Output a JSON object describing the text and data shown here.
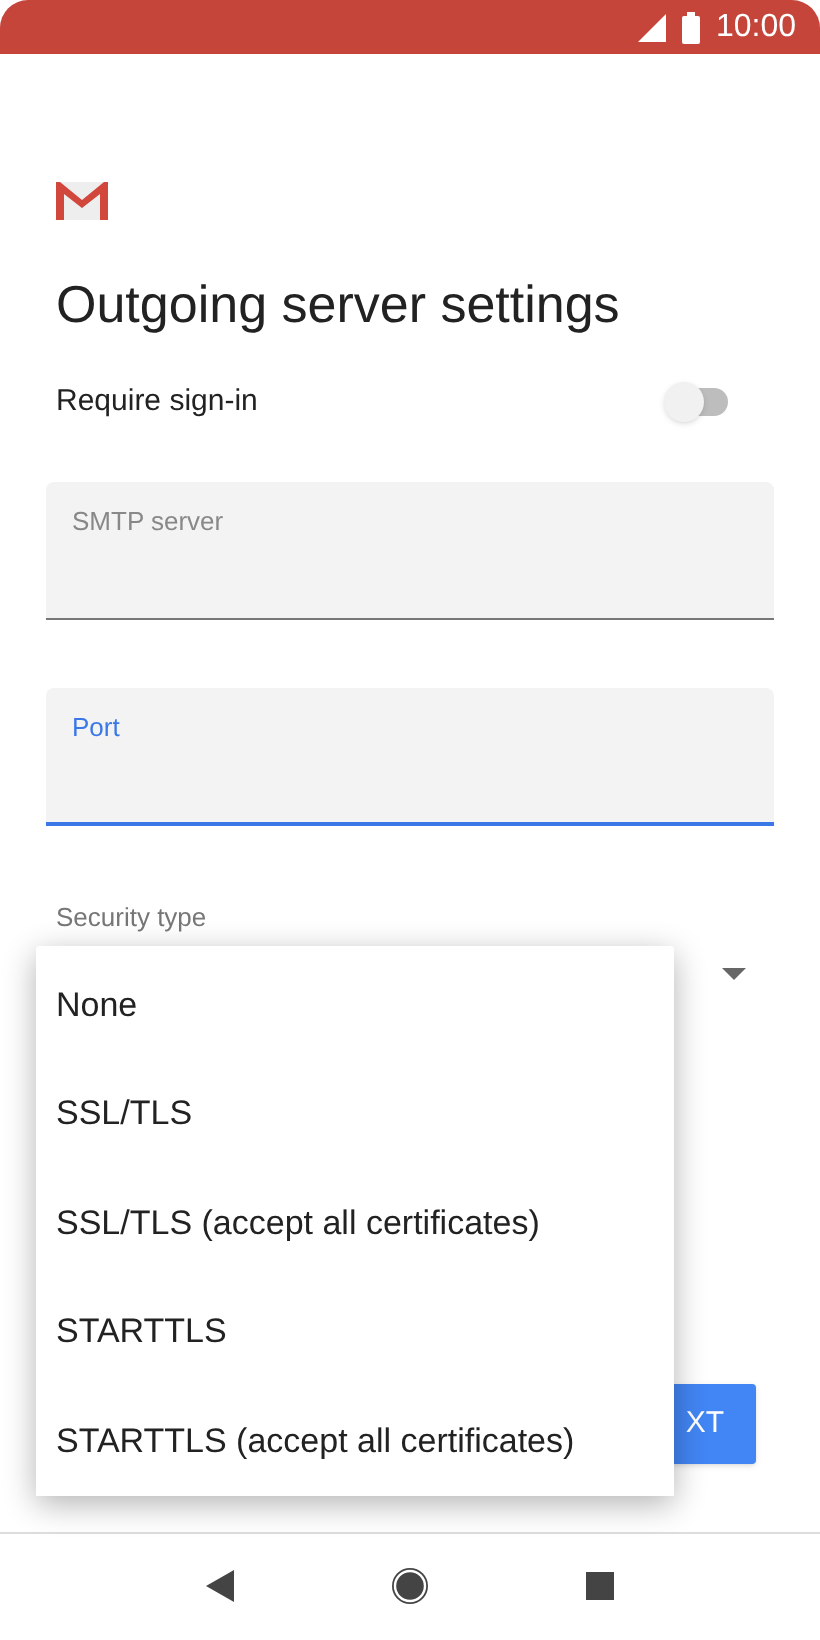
{
  "status_bar": {
    "time": "10:00"
  },
  "title": "Outgoing server settings",
  "require_sign_in": {
    "label": "Require sign-in",
    "on": false
  },
  "fields": [
    {
      "placeholder": "SMTP server",
      "focused": false
    },
    {
      "placeholder": "Port",
      "focused": true
    }
  ],
  "security_type": {
    "label": "Security type",
    "options": [
      {
        "label": "None",
        "selected": false
      },
      {
        "label": "SSL/TLS",
        "selected": false
      },
      {
        "label": "SSL/TLS (accept all certificates)",
        "selected": false
      },
      {
        "label": "STARTTLS",
        "selected": false
      },
      {
        "label": "STARTTLS (accept all certificates)",
        "selected": false
      }
    ]
  },
  "next_button": {
    "label": "XT"
  }
}
